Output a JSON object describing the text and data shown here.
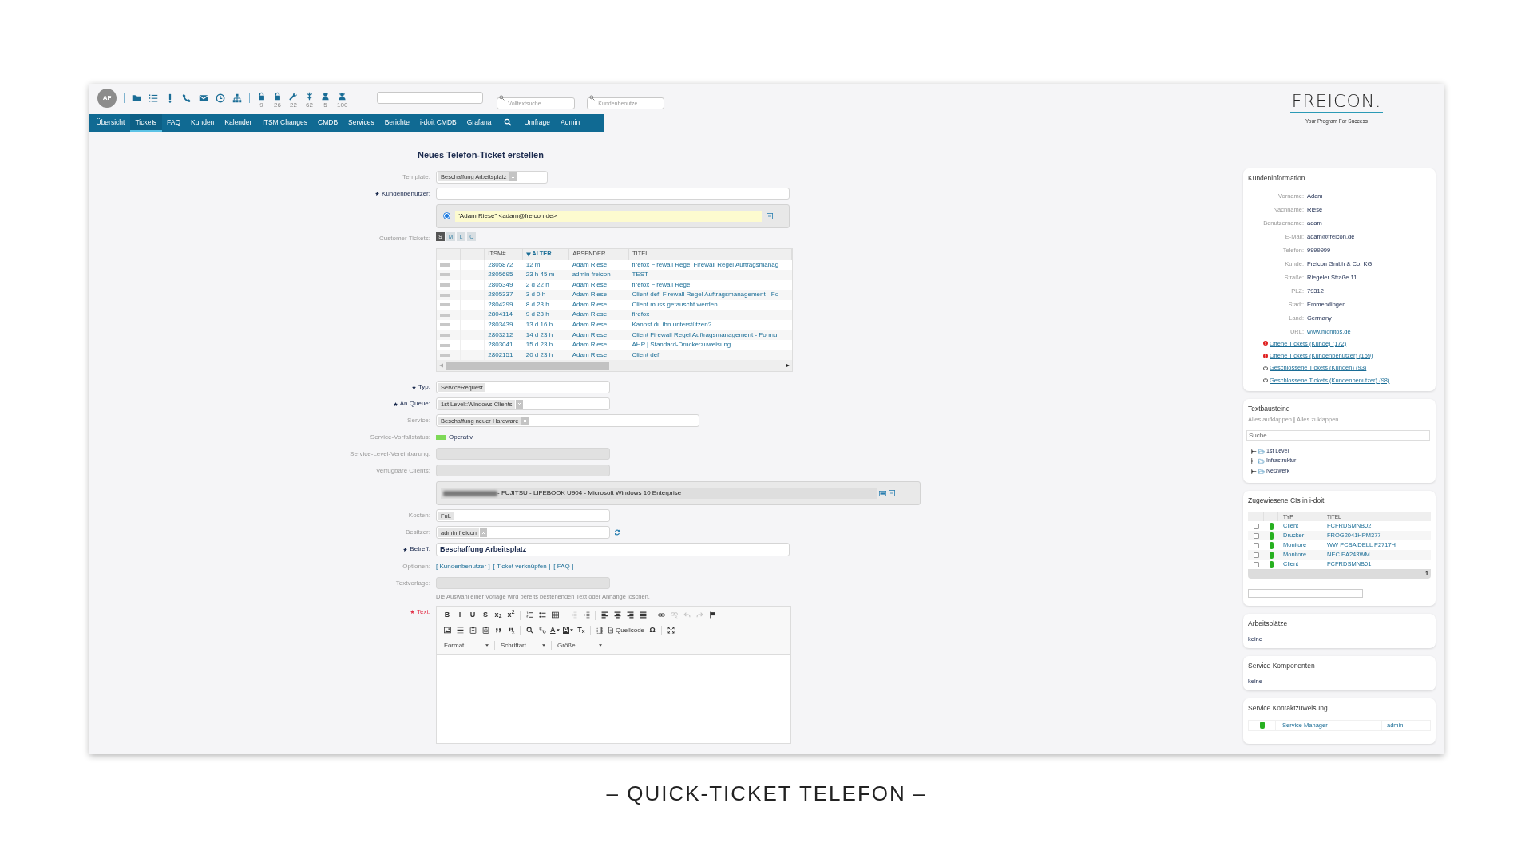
{
  "toolbar": {
    "avatar": "AF",
    "counters": [
      "9",
      "26",
      "22",
      "62",
      "5",
      "100"
    ],
    "search_fields": [
      {
        "placeholder": "Volltextsuche"
      },
      {
        "placeholder": "Kundenbenutze..."
      }
    ]
  },
  "navigation": [
    {
      "kind": "link",
      "label": "Übersicht",
      "selected": false
    },
    {
      "kind": "link",
      "label": "Tickets",
      "selected": true
    },
    {
      "kind": "link",
      "label": "FAQ",
      "selected": false
    },
    {
      "kind": "link",
      "label": "Kunden",
      "selected": false
    },
    {
      "kind": "link",
      "label": "Kalender",
      "selected": false
    },
    {
      "kind": "link",
      "label": "ITSM Changes",
      "selected": false
    },
    {
      "kind": "link",
      "label": "CMDB",
      "selected": false
    },
    {
      "kind": "link",
      "label": "Services",
      "selected": false
    },
    {
      "kind": "link",
      "label": "Berichte",
      "selected": false
    },
    {
      "kind": "link",
      "label": "i-doit CMDB",
      "selected": false
    },
    {
      "kind": "link",
      "label": "Grafana",
      "selected": false
    },
    {
      "kind": "search",
      "selected": false
    },
    {
      "kind": "link",
      "label": "Umfrage",
      "selected": false
    },
    {
      "kind": "link",
      "label": "Admin",
      "selected": false
    }
  ],
  "logo": {
    "name": "FREICON.",
    "tagline": "Your Program For Success"
  },
  "form": {
    "title": "Neues Telefon-Ticket erstellen",
    "template": {
      "label": "Template:",
      "required": false,
      "token": "Beschaffung Arbeitsplatz",
      "removable": true
    },
    "customer_user": {
      "label": "Kundenbenutzer:",
      "required": true,
      "selected_customer": {
        "value": "\"Adam Riese\" <adam@freicon.de>",
        "selected": true
      }
    },
    "customer_tickets": {
      "label": "Customer Tickets:",
      "required": false,
      "sizes": [
        {
          "label": "S",
          "selected": true
        },
        {
          "label": "M",
          "selected": false
        },
        {
          "label": "L",
          "selected": false
        },
        {
          "label": "C",
          "selected": false
        }
      ],
      "columns": [
        {
          "label": "ITSM#",
          "sorted": false
        },
        {
          "label": "ALTER",
          "sorted": true
        },
        {
          "label": "ABSENDER",
          "sorted": false
        },
        {
          "label": "TITEL",
          "sorted": false
        }
      ],
      "rows": [
        {
          "number": "2805872",
          "age": "12 m",
          "sender": "Adam Riese",
          "title": "firefox Firewall Regel Firewall Regel Auftragsmanag"
        },
        {
          "number": "2805695",
          "age": "23 h 45 m",
          "sender": "admin freicon",
          "title": "TEST"
        },
        {
          "number": "2805349",
          "age": "2 d 22 h",
          "sender": "Adam Riese",
          "title": "firefox Firewall Regel"
        },
        {
          "number": "2805337",
          "age": "3 d 0 h",
          "sender": "Adam Riese",
          "title": "Client def. Firewall Regel Auftragsmanagement - Fo"
        },
        {
          "number": "2804299",
          "age": "8 d 23 h",
          "sender": "Adam Riese",
          "title": "Client muss getauscht werden"
        },
        {
          "number": "2804114",
          "age": "9 d 23 h",
          "sender": "Adam Riese",
          "title": "firefox"
        },
        {
          "number": "2803439",
          "age": "13 d 16 h",
          "sender": "Adam Riese",
          "title": "Kannst du ihn unterstützen?"
        },
        {
          "number": "2803212",
          "age": "14 d 23 h",
          "sender": "Adam Riese",
          "title": "Client Firewall Regel Auftragsmanagement - Formu"
        },
        {
          "number": "2803041",
          "age": "15 d 23 h",
          "sender": "Adam Riese",
          "title": "AHP | Standard-Druckerzuweisung"
        },
        {
          "number": "2802151",
          "age": "20 d 23 h",
          "sender": "Adam Riese",
          "title": "Client def."
        }
      ]
    },
    "type": {
      "label": "Typ:",
      "required": true,
      "token": "ServiceRequest",
      "removable": false
    },
    "queue": {
      "label": "An Queue:",
      "required": true,
      "token": "1st Level::Windows Clients",
      "removable": true
    },
    "service": {
      "label": "Service:",
      "required": false,
      "token": "Beschaffung neuer Hardware",
      "removable": true
    },
    "incident_state": {
      "label": "Service-Vorfallstatus:",
      "required": false,
      "value": "Operativ"
    },
    "sla": {
      "label": "Service-Level-Vereinbarung:",
      "required": false,
      "disabled": true
    },
    "available_clients": {
      "label": "Verfügbare Clients:",
      "required": false,
      "disabled": true
    },
    "client": {
      "value": "- FUJITSU - LIFEBOOK U904 - Microsoft Windows 10 Enterprise"
    },
    "cost": {
      "label": "Kosten:",
      "required": false,
      "token": "FuL",
      "removable": false
    },
    "owner": {
      "label": "Besitzer:",
      "required": false,
      "token": "admin freicon",
      "removable": true
    },
    "subject": {
      "label": "Betreff:",
      "required": true,
      "value": "Beschaffung Arbeitsplatz"
    },
    "options": {
      "label": "Optionen:",
      "required": false,
      "links": [
        "[ Kundenbenutzer ]",
        "[ Ticket verknüpfen ]",
        "[ FAQ ]"
      ]
    },
    "text_template": {
      "label": "Textvorlage:",
      "required": false,
      "disabled": true,
      "hint": "Die Auswahl einer Vorlage wird bereits bestehenden Text oder Anhänge löschen."
    },
    "text": {
      "label": "Text:",
      "required": true,
      "invalid": true,
      "toolbar_rows": [
        [
          [
            {
              "kind": "glyph",
              "glyph": "B",
              "disabled": false
            },
            {
              "kind": "glyph",
              "glyph": "I",
              "disabled": false
            },
            {
              "kind": "glyph",
              "glyph": "U",
              "disabled": false
            },
            {
              "kind": "glyph",
              "glyph": "S",
              "disabled": false
            },
            {
              "kind": "glyph",
              "glyph": "x$_{2}$",
              "disabled": false
            },
            {
              "kind": "glyph",
              "glyph": "x$^{2}$",
              "disabled": false
            }
          ],
          [
            {
              "kind": "icon",
              "disabled": false
            },
            {
              "kind": "icon",
              "disabled": false
            },
            {
              "kind": "icon",
              "disabled": false
            }
          ],
          [
            {
              "kind": "icon",
              "disabled": true
            },
            {
              "kind": "icon",
              "disabled": false
            }
          ],
          [
            {
              "kind": "icon",
              "disabled": false
            },
            {
              "kind": "icon",
              "disabled": false
            },
            {
              "kind": "icon",
              "disabled": false
            },
            {
              "kind": "icon",
              "disabled": false
            }
          ],
          [
            {
              "kind": "icon",
              "disabled": false
            },
            {
              "kind": "icon",
              "disabled": true
            },
            {
              "kind": "icon",
              "disabled": true
            },
            {
              "kind": "icon",
              "disabled": true
            },
            {
              "kind": "icon",
              "disabled": false
            }
          ]
        ],
        [
          [
            {
              "kind": "icon",
              "disabled": false
            },
            {
              "kind": "icon",
              "disabled": false
            },
            {
              "kind": "icon",
              "disabled": false
            },
            {
              "kind": "icon",
              "disabled": false
            },
            {
              "kind": "icon",
              "disabled": false
            },
            {
              "kind": "icon",
              "disabled": false
            }
          ],
          [
            {
              "kind": "icon",
              "disabled": false
            },
            {
              "kind": "icon",
              "disabled": false
            },
            {
              "kind": "glyph-menu",
              "glyph": "A",
              "disabled": false
            },
            {
              "kind": "boxed-menu",
              "glyph": "A",
              "disabled": false
            },
            {
              "kind": "glyph",
              "glyph": "T$_{x}$",
              "disabled": false
            }
          ],
          [
            {
              "kind": "icon",
              "disabled": false
            },
            {
              "kind": "labeled",
              "label": "Quellcode",
              "disabled": false
            },
            {
              "kind": "glyph",
              "glyph": "Ω",
              "disabled": false
            }
          ],
          [
            {
              "kind": "icon",
              "disabled": false
            }
          ]
        ]
      ],
      "dropdowns": [
        "Format",
        "Schriftart",
        "Größe"
      ]
    }
  },
  "sidebar": {
    "customer_info": {
      "title": "Kundeninformation",
      "fields": [
        {
          "label": "Vorname:",
          "value": "Adam",
          "link": false
        },
        {
          "label": "Nachname:",
          "value": "Riese",
          "link": false
        },
        {
          "label": "Benutzername:",
          "value": "adam",
          "link": false
        },
        {
          "label": "E-Mail:",
          "value": "adam@freicon.de",
          "link": false
        },
        {
          "label": "Telefon:",
          "value": "9999999",
          "link": false
        },
        {
          "label": "Kunde:",
          "value": "Freicon Gmbh & Co. KG",
          "link": false
        },
        {
          "label": "Straße:",
          "value": "Riegeler Straße 11",
          "link": false
        },
        {
          "label": "PLZ:",
          "value": "79312",
          "link": false
        },
        {
          "label": "Stadt:",
          "value": "Emmendingen",
          "link": false
        },
        {
          "label": "Land:",
          "value": "Germany",
          "link": false
        },
        {
          "label": "URL:",
          "value": "www.monitos.de",
          "link": true
        }
      ],
      "links": [
        {
          "kind": "open",
          "label": "Offene Tickets (Kunde) (172)"
        },
        {
          "kind": "open",
          "label": "Offene Tickets (Kundenbenutzer) (159)"
        },
        {
          "kind": "closed",
          "label": "Geschlossene Tickets (Kunden) (93)"
        },
        {
          "kind": "closed",
          "label": "Geschlossene Tickets (Kundenbenutzer) (98)"
        }
      ]
    },
    "text_modules": {
      "title": "Textbausteine",
      "actions": [
        "Alles aufklappen",
        "Alles zuklappen"
      ],
      "separator": "|",
      "search_placeholder": "Suche",
      "tree": [
        {
          "label": "1st Level",
          "expanded": false
        },
        {
          "label": "Infrastruktur",
          "expanded": false
        },
        {
          "label": "Netzwerk",
          "expanded": false
        }
      ]
    },
    "cis": {
      "title": "Zugewiesene CIs in i-doit",
      "columns": [
        "TYP",
        "TITEL"
      ],
      "rows": [
        {
          "type": "Client",
          "title": "FCFRDSMNB02",
          "checked": false
        },
        {
          "type": "Drucker",
          "title": "FROG2041HPM377",
          "checked": false
        },
        {
          "type": "Monitore",
          "title": "WW PCBA DELL P2717H",
          "checked": false
        },
        {
          "type": "Monitore",
          "title": "NEC EA243WM",
          "checked": false
        },
        {
          "type": "Client",
          "title": "FCFRDSMNB01",
          "checked": false
        }
      ],
      "page": "1"
    },
    "workplaces": {
      "title": "Arbeitsplätze",
      "value": "keine"
    },
    "service_components": {
      "title": "Service Komponenten",
      "value": "keine"
    },
    "service_contacts": {
      "title": "Service Kontaktzuweisung",
      "rows": [
        {
          "role": "Service Manager",
          "user": "admin"
        }
      ]
    }
  },
  "caption": "– QUICK-TICKET TELEFON –"
}
